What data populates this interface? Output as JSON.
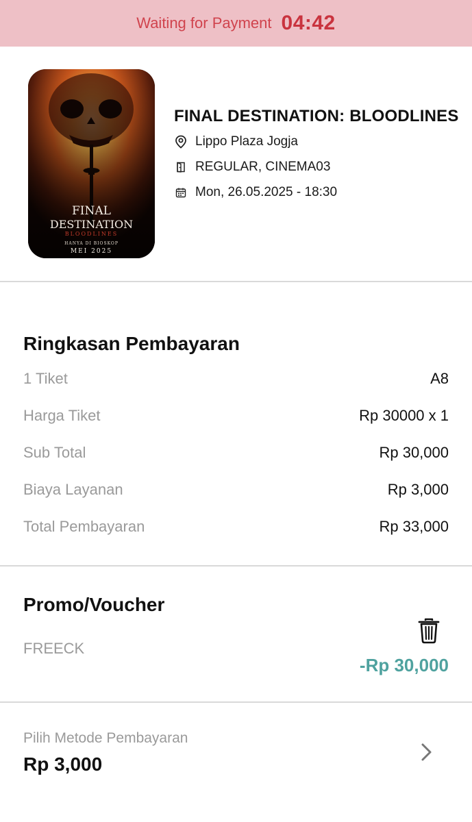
{
  "banner": {
    "text": "Waiting for Payment",
    "timer": "04:42",
    "background": "#eec0c6",
    "text_color": "#d0434d"
  },
  "movie": {
    "title": "FINAL DESTINATION: BLOODLINES",
    "location": "Lippo Plaza Jogja",
    "studio": "REGULAR, CINEMA03",
    "schedule": "Mon, 26.05.2025 - 18:30",
    "poster": {
      "title_line1": "FINAL",
      "title_line2": "DESTINATION",
      "subtitle": "BLOODLINES",
      "tagline": "HANYA DI BIOSKOP",
      "release": "MEI 2025"
    },
    "icons": {
      "location": "location-pin-icon",
      "studio": "door-icon",
      "schedule": "calendar-icon"
    }
  },
  "summary": {
    "title": "Ringkasan Pembayaran",
    "rows": [
      {
        "label": "1 Tiket",
        "value": "A8"
      },
      {
        "label": "Harga Tiket",
        "value": "Rp 30000 x 1"
      },
      {
        "label": "Sub Total",
        "value": "Rp 30,000"
      },
      {
        "label": "Biaya Layanan",
        "value": "Rp 3,000"
      },
      {
        "label": "Total Pembayaran",
        "value": "Rp 33,000"
      }
    ]
  },
  "promo": {
    "title": "Promo/Voucher",
    "code": "FREECK",
    "discount": "-Rp 30,000",
    "discount_color": "#4fa29f",
    "remove_icon": "trash-icon"
  },
  "payment": {
    "label": "Pilih Metode Pembayaran",
    "amount": "Rp 3,000",
    "chevron_icon": "chevron-right-icon"
  }
}
